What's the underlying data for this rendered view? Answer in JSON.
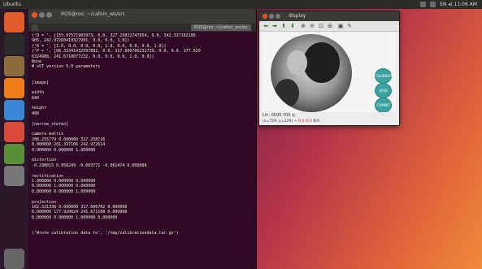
{
  "topbar": {
    "title": "Ubuntu",
    "status": "EN  ◂)  11:06 AM"
  },
  "launcher": {
    "items": [
      {
        "name": "dash-home-icon",
        "color": "#e05d2a"
      },
      {
        "name": "terminal-app-icon",
        "color": "#2b2b2b"
      },
      {
        "name": "files-app-icon",
        "color": "#8a6d3b"
      },
      {
        "name": "firefox-app-icon",
        "color": "#f07d1a"
      },
      {
        "name": "settings-app-icon",
        "color": "#3a86d6"
      },
      {
        "name": "software-app-icon",
        "color": "#d84a3a"
      },
      {
        "name": "text-editor-app-icon",
        "color": "#5a8f3a"
      },
      {
        "name": "system-settings-icon",
        "color": "#777777"
      },
      {
        "name": "trash-icon",
        "color": "#666666"
      }
    ]
  },
  "terminal": {
    "title": "ROS@ros: ~/catkin_ws/src",
    "tab_label": "ROS@ros: ~/catkin_ws/src",
    "lines": [
      "('D = ', [155.07571903973, 0.0, 327.29822747654, 0.0, 342.337182206",
      "905, 242.97260410327991, 0.0, 0.0, 1.0])",
      "('R = ', [1.0, 0.0, 0.0, 0.0, 1.0, 0.0, 0.0, 0.0, 1.0])",
      "('P = ', [96.33341432597882, 0.0, 317.606706232739, 0.0, 0.0, 177.920",
      "6324988, 241.6710077232, 0.0, 0.0, 0.0, 1.0, 0.0])",
      "None",
      "# oST version 5.0 parameters",
      "",
      "",
      "[image]",
      "",
      "width",
      "640",
      "",
      "height",
      "480",
      "",
      "[narrow_stereo]",
      "",
      "camera matrix",
      "208.255779 0.000000 317.258726",
      "0.000000 201.337106 242.972614",
      "0.000000 0.000000 1.000000",
      "",
      "distortion",
      "-0.298015 0.058249 -0.003771 -0.001474 0.000000",
      "",
      "rectification",
      "1.000000 0.000000 0.000000",
      "0.000000 1.000000 0.000000",
      "0.000000 0.000000 1.000000",
      "",
      "projection",
      "102.321336 0.000000 317.606702 0.000000",
      "0.000000 177.920624 241.671108 0.000000",
      "0.000000 0.000000 1.000000 0.000000",
      "",
      "",
      "('Wrote calibration data to', '/tmp/calibrationdata.tar.gz')"
    ]
  },
  "viewer": {
    "title": "display",
    "buttons": [
      "CALIBRATE",
      "SAVE",
      "COMMIT"
    ],
    "status": "Lin:  0000 Y00  ◎",
    "coords_prefix": "(x=729, y=229) ~",
    "coords_rgb": "R:0 G:0",
    "coords_b": "B:0"
  }
}
